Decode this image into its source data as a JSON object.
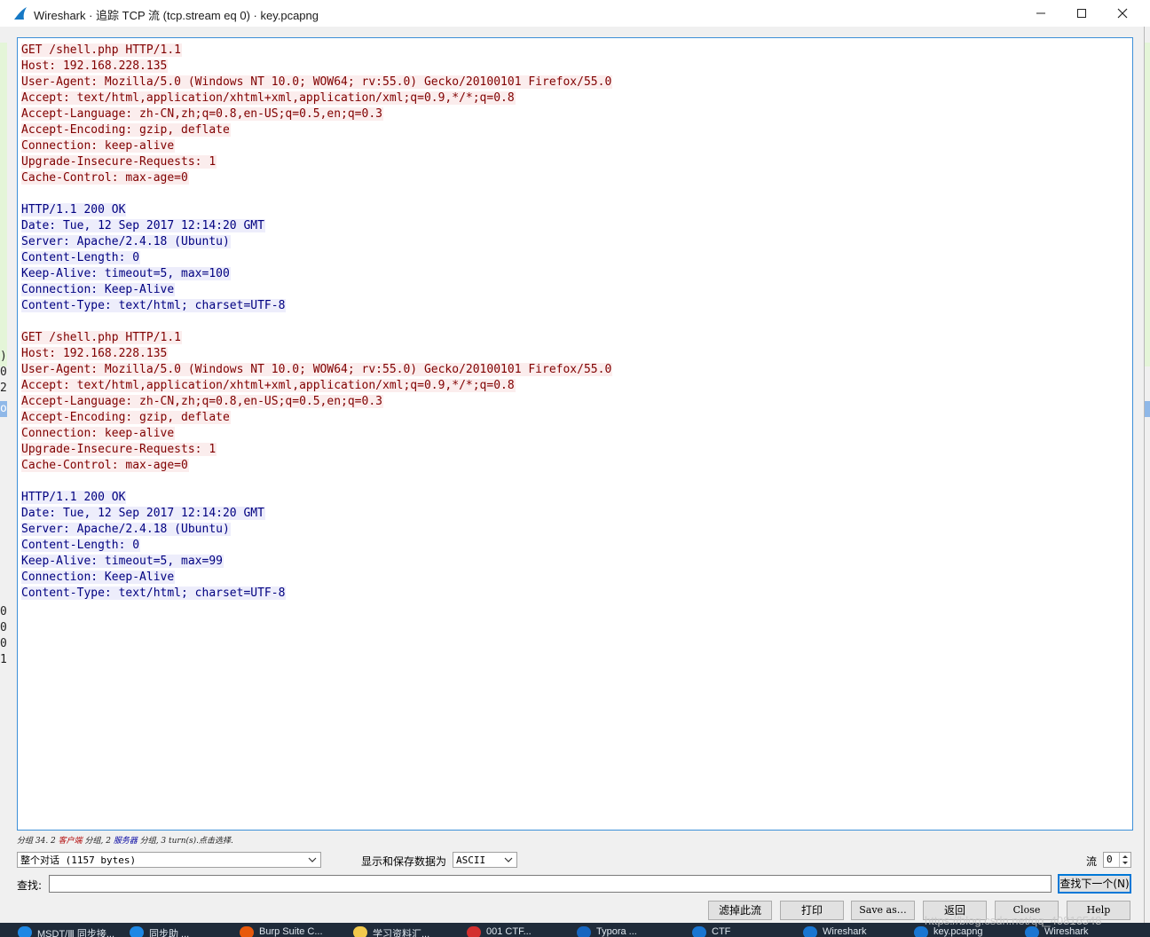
{
  "window": {
    "title": "Wireshark · 追踪 TCP 流 (tcp.stream eq 0) · key.pcapng"
  },
  "background_chars": {
    "left": [
      ")",
      "0",
      "2",
      "o",
      "0",
      "0",
      "0",
      "1"
    ],
    "right": []
  },
  "stream": [
    {
      "side": "client",
      "text": "GET /shell.php HTTP/1.1"
    },
    {
      "side": "client",
      "text": "Host: 192.168.228.135"
    },
    {
      "side": "client",
      "text": "User-Agent: Mozilla/5.0 (Windows NT 10.0; WOW64; rv:55.0) Gecko/20100101 Firefox/55.0"
    },
    {
      "side": "client",
      "text": "Accept: text/html,application/xhtml+xml,application/xml;q=0.9,*/*;q=0.8"
    },
    {
      "side": "client",
      "text": "Accept-Language: zh-CN,zh;q=0.8,en-US;q=0.5,en;q=0.3"
    },
    {
      "side": "client",
      "text": "Accept-Encoding: gzip, deflate"
    },
    {
      "side": "client",
      "text": "Connection: keep-alive"
    },
    {
      "side": "client",
      "text": "Upgrade-Insecure-Requests: 1"
    },
    {
      "side": "client",
      "text": "Cache-Control: max-age=0"
    },
    {
      "side": "blank",
      "text": ""
    },
    {
      "side": "server",
      "text": "HTTP/1.1 200 OK"
    },
    {
      "side": "server",
      "text": "Date: Tue, 12 Sep 2017 12:14:20 GMT"
    },
    {
      "side": "server",
      "text": "Server: Apache/2.4.18 (Ubuntu)"
    },
    {
      "side": "server",
      "text": "Content-Length: 0"
    },
    {
      "side": "server",
      "text": "Keep-Alive: timeout=5, max=100"
    },
    {
      "side": "server",
      "text": "Connection: Keep-Alive"
    },
    {
      "side": "server",
      "text": "Content-Type: text/html; charset=UTF-8"
    },
    {
      "side": "blank",
      "text": ""
    },
    {
      "side": "client",
      "text": "GET /shell.php HTTP/1.1"
    },
    {
      "side": "client",
      "text": "Host: 192.168.228.135"
    },
    {
      "side": "client",
      "text": "User-Agent: Mozilla/5.0 (Windows NT 10.0; WOW64; rv:55.0) Gecko/20100101 Firefox/55.0"
    },
    {
      "side": "client",
      "text": "Accept: text/html,application/xhtml+xml,application/xml;q=0.9,*/*;q=0.8"
    },
    {
      "side": "client",
      "text": "Accept-Language: zh-CN,zh;q=0.8,en-US;q=0.5,en;q=0.3"
    },
    {
      "side": "client",
      "text": "Accept-Encoding: gzip, deflate"
    },
    {
      "side": "client",
      "text": "Connection: keep-alive"
    },
    {
      "side": "client",
      "text": "Upgrade-Insecure-Requests: 1"
    },
    {
      "side": "client",
      "text": "Cache-Control: max-age=0"
    },
    {
      "side": "blank",
      "text": ""
    },
    {
      "side": "server",
      "text": "HTTP/1.1 200 OK"
    },
    {
      "side": "server",
      "text": "Date: Tue, 12 Sep 2017 12:14:20 GMT"
    },
    {
      "side": "server",
      "text": "Server: Apache/2.4.18 (Ubuntu)"
    },
    {
      "side": "server",
      "text": "Content-Length: 0"
    },
    {
      "side": "server",
      "text": "Keep-Alive: timeout=5, max=99"
    },
    {
      "side": "server",
      "text": "Connection: Keep-Alive"
    },
    {
      "side": "server",
      "text": "Content-Type: text/html; charset=UTF-8"
    }
  ],
  "summary": {
    "prefix": "分组 34. 2 ",
    "client": "客户端",
    "middle": " 分组, 2 ",
    "server": "服务器",
    "suffix": " 分组, 3 turn(s).点击选择."
  },
  "controls": {
    "conversation_select": "整个对话 (1157 bytes)",
    "show_as_label": "显示和保存数据为",
    "show_as_value": "ASCII",
    "stream_label": "流",
    "stream_value": "0",
    "find_label": "查找:",
    "find_value": "",
    "find_next_button": "查找下一个(N)"
  },
  "buttons": {
    "filter_out": "滤掉此流",
    "print": "打印",
    "save_as": "Save as…",
    "back": "返回",
    "close": "Close",
    "help": "Help"
  },
  "watermark": "https://blog.csdn.net/qq_40816548",
  "taskbar": [
    {
      "label": "MSDT/Ⅲ 同步接...",
      "color": "#1e88e5"
    },
    {
      "label": "同步助 ...",
      "color": "#1e88e5"
    },
    {
      "label": "Burp Suite C...",
      "color": "#e8590c"
    },
    {
      "label": "学习资料汇...",
      "color": "#f2c94c"
    },
    {
      "label": "001 CTF...",
      "color": "#d32f2f"
    },
    {
      "label": "Typora ...",
      "color": "#1565c0"
    },
    {
      "label": "CTF",
      "color": "#1976d2"
    },
    {
      "label": "Wireshark",
      "color": "#1976d2"
    },
    {
      "label": "key.pcapng",
      "color": "#1976d2"
    },
    {
      "label": "Wireshark",
      "color": "#1976d2"
    }
  ],
  "colors": {
    "client_text": "#800000",
    "client_bg": "#fbeded",
    "server_text": "#000080",
    "server_bg": "#ededfb",
    "accent": "#0078d7"
  }
}
